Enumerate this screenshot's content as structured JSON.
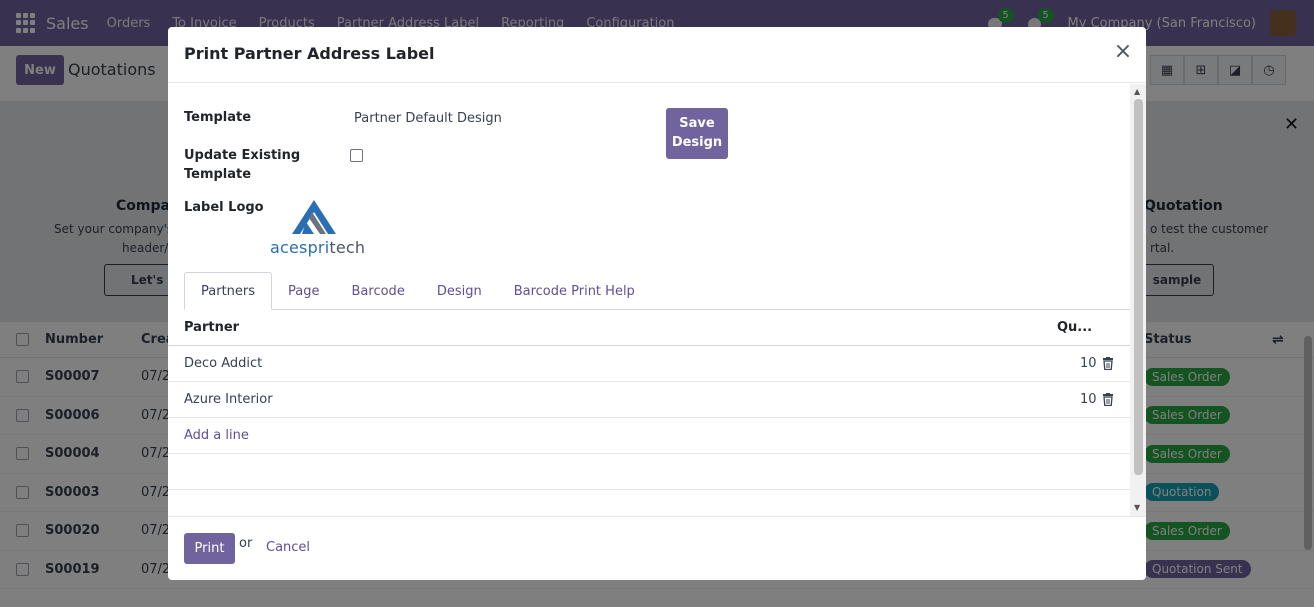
{
  "navbar": {
    "app_name": "Sales",
    "menu": [
      "Orders",
      "To Invoice",
      "Products",
      "Partner Address Label",
      "Reporting",
      "Configuration"
    ],
    "messages_badge": "5",
    "activities_badge": "5",
    "company": "My Company (San Francisco)"
  },
  "control": {
    "new_label": "New",
    "breadcrumb": "Quotations"
  },
  "helper": {
    "left_title": "Compan",
    "left_line1": "Set your company's d",
    "left_line2": "header/",
    "left_button": "Let's s",
    "right_title": "Quotation",
    "right_line1": "o test the customer",
    "right_line2": "rtal.",
    "right_button": "sample"
  },
  "list": {
    "columns": {
      "number": "Number",
      "creation": "Crea",
      "status": "Status"
    },
    "rows": [
      {
        "number": "S00007",
        "date": "07/2",
        "status": "Sales Order",
        "color": "green"
      },
      {
        "number": "S00006",
        "date": "07/2",
        "status": "Sales Order",
        "color": "green"
      },
      {
        "number": "S00004",
        "date": "07/2",
        "status": "Sales Order",
        "color": "green"
      },
      {
        "number": "S00003",
        "date": "07/2",
        "status": "Quotation",
        "color": "blue"
      },
      {
        "number": "S00020",
        "date": "07/2",
        "status": "Sales Order",
        "color": "green"
      },
      {
        "number": "S00019",
        "date": "07/2",
        "status": "Quotation Sent",
        "color": "purple"
      }
    ]
  },
  "modal": {
    "title": "Print Partner Address Label",
    "template_label": "Template",
    "template_value": "Partner Default Design",
    "update_label_1": "Update Existing",
    "update_label_2": "Template",
    "logo_label": "Label Logo",
    "logo_text_1": "acespri",
    "logo_text_2": "tech",
    "save_line1": "Save",
    "save_line2": "Design",
    "tabs": [
      "Partners",
      "Page",
      "Barcode",
      "Design",
      "Barcode Print Help"
    ],
    "table_header_partner": "Partner",
    "table_header_qty": "Qu...",
    "partners": [
      {
        "name": "Deco Addict",
        "qty": "10"
      },
      {
        "name": "Azure Interior",
        "qty": "10"
      }
    ],
    "add_line": "Add a line",
    "print_label": "Print",
    "or_label": "or",
    "cancel_label": "Cancel"
  },
  "colors": {
    "brand": "#71639e",
    "link": "#5f4f93",
    "badge_green": "#28a745",
    "badge_blue": "#17a2b8"
  }
}
